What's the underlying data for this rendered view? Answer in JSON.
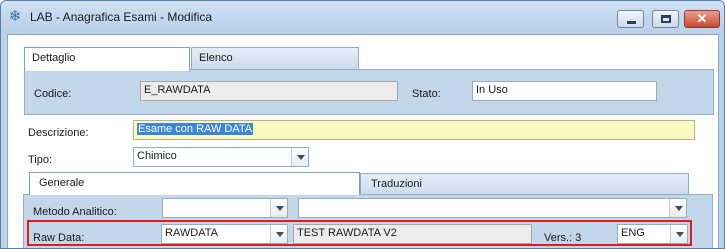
{
  "window": {
    "title": "LAB - Anagrafica Esami - Modifica"
  },
  "tabs": {
    "dettaglio": "Dettaglio",
    "elenco": "Elenco"
  },
  "header": {
    "codice_label": "Codice:",
    "codice_value": "E_RAWDATA",
    "stato_label": "Stato:",
    "stato_value": "In Uso"
  },
  "descrizione": {
    "label": "Descrizione:",
    "value": "Esame con RAW DATA"
  },
  "tipo": {
    "label": "Tipo:",
    "value": "Chimico"
  },
  "subtabs": {
    "generale": "Generale",
    "traduzioni": "Traduzioni"
  },
  "metodo": {
    "label": "Metodo Analitico:",
    "code": "",
    "description": ""
  },
  "raw_data": {
    "label": "Raw Data:",
    "code": "RAWDATA",
    "description": "TEST RAWDATA V2",
    "version_label": "Vers.: 3",
    "language": "ENG"
  },
  "colors": {
    "highlight": "#e01d1d",
    "selection": "#3b86d8",
    "panel": "#c4d6ea"
  },
  "icons": {
    "app": "snowflake-icon",
    "min": "minimize-icon",
    "max": "maximize-icon",
    "close": "close-icon"
  }
}
